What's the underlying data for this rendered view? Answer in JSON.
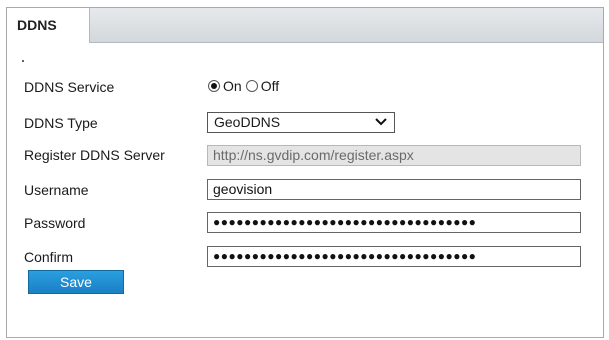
{
  "tab": {
    "label": "DDNS"
  },
  "form": {
    "service": {
      "label": "DDNS Service",
      "on_label": "On",
      "off_label": "Off",
      "selected": "On"
    },
    "type": {
      "label": "DDNS Type",
      "value": "GeoDDNS"
    },
    "server": {
      "label": "Register DDNS Server",
      "value": "http://ns.gvdip.com/register.aspx"
    },
    "username": {
      "label": "Username",
      "value": "geovision"
    },
    "password": {
      "label": "Password",
      "value": "●●●●●●●●●●●●●●●●●●●●●●●●●●●●●●●●●●"
    },
    "confirm": {
      "label": "Confirm",
      "value": "●●●●●●●●●●●●●●●●●●●●●●●●●●●●●●●●●●"
    },
    "save_label": "Save"
  }
}
